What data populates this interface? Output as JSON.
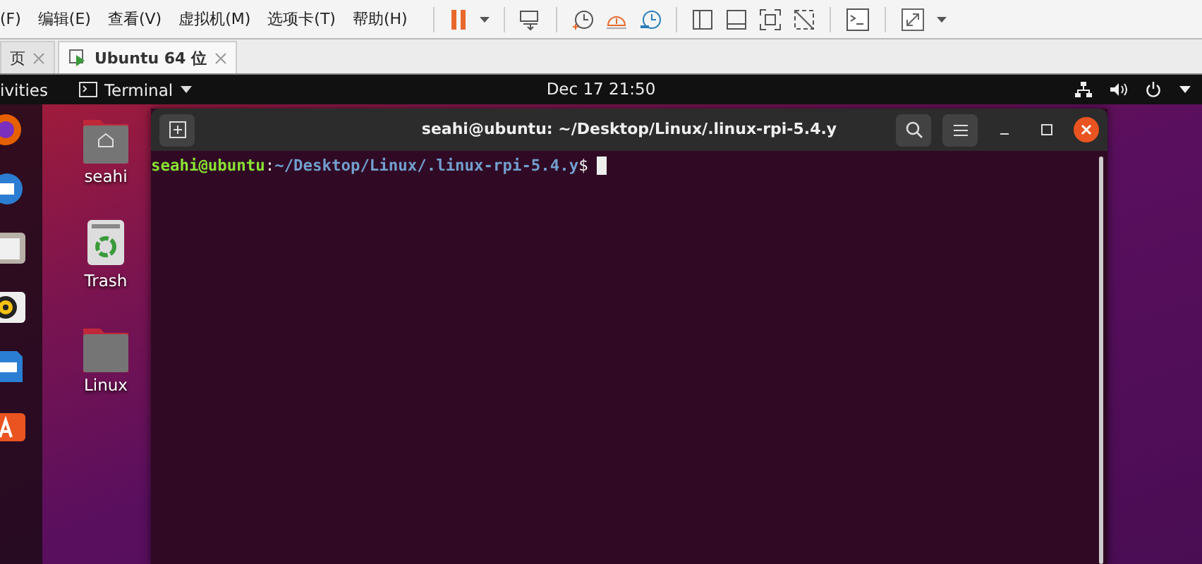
{
  "vm_menu": [
    "(F)",
    "编辑(E)",
    "查看(V)",
    "虚拟机(M)",
    "选项卡(T)",
    "帮助(H)"
  ],
  "vm_tabs": [
    {
      "label": "页",
      "selected": false
    },
    {
      "label": "Ubuntu 64 位",
      "selected": true
    }
  ],
  "top_bar": {
    "activities": "ivities",
    "app_menu": "Terminal",
    "clock": "Dec 17  21:50"
  },
  "desktop_icons": [
    {
      "kind": "home",
      "label": "seahi"
    },
    {
      "kind": "trash",
      "label": "Trash"
    },
    {
      "kind": "folder",
      "label": "Linux"
    }
  ],
  "terminal": {
    "title": "seahi@ubuntu: ~/Desktop/Linux/.linux-rpi-5.4.y",
    "prompt_user": "seahi@ubuntu",
    "prompt_sep": ":",
    "prompt_path": "~/Desktop/Linux/.linux-rpi-5.4.y",
    "prompt_symbol": "$"
  }
}
